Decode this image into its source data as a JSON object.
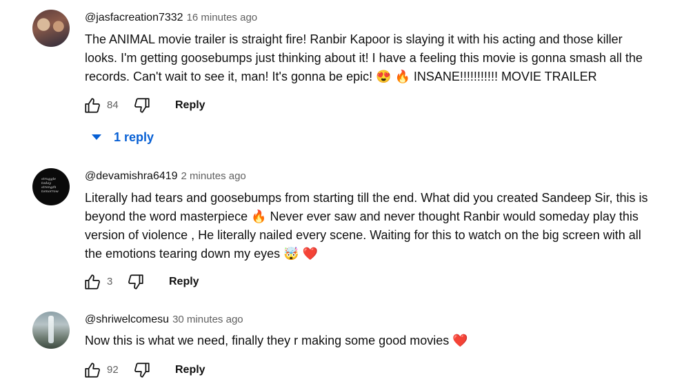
{
  "comments": [
    {
      "handle": "@jasfacreation7332",
      "time": "16 minutes ago",
      "text": "The ANIMAL movie trailer is straight fire! Ranbir Kapoor is slaying it with his acting and those killer looks. I'm getting goosebumps just thinking about it! I have a feeling this movie is gonna smash all the records. Can't wait to see it, man! It's gonna be epic! 😍 🔥 INSANE!!!!!!!!!!! MOVIE TRAILER",
      "likes": "84",
      "reply_label": "Reply",
      "replies_label": "1 reply"
    },
    {
      "handle": "@devamishra6419",
      "time": "2 minutes ago",
      "text": "Literally had tears and goosebumps from starting till the end. What did you created Sandeep Sir, this is beyond the word masterpiece 🔥 Never ever saw and never thought Ranbir would someday play this version of violence , He literally nailed every scene. Waiting for this to watch on the big screen with all the emotions tearing down my eyes 🤯 ❤️",
      "likes": "3",
      "reply_label": "Reply",
      "avatar_text": "struggle today strength tomorrow"
    },
    {
      "handle": "@shriwelcomesu",
      "time": "30 minutes ago",
      "text": "Now this is what we need, finally they r making some good movies ❤️",
      "likes": "92",
      "reply_label": "Reply"
    }
  ],
  "icons": {
    "like": "thumbs-up-outline",
    "dislike": "thumbs-down-outline",
    "expand": "triangle-down"
  },
  "colors": {
    "link_blue": "#065fd4",
    "secondary_text": "#606060",
    "primary_text": "#0f0f0f"
  }
}
